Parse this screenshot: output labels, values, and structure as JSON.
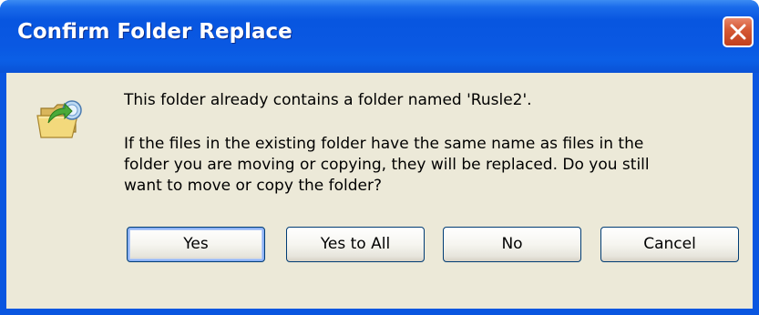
{
  "dialog": {
    "title": "Confirm Folder Replace",
    "close_icon": "close-icon",
    "folder_icon": "folder-move-icon",
    "message_line1": "This folder already contains a folder named 'Rusle2'.",
    "message_line2": "If the files in the existing folder have the same name as files in the",
    "message_line3": "folder you are moving or copying, they will be replaced.  Do you still",
    "message_line4": "want to move or copy the folder?"
  },
  "buttons": {
    "yes": "Yes",
    "yes_to_all": "Yes to All",
    "no": "No",
    "cancel": "Cancel"
  },
  "colors": {
    "titlebar": "#0a56e0",
    "client_background": "#ece9d8",
    "close_button": "#d65a36"
  }
}
